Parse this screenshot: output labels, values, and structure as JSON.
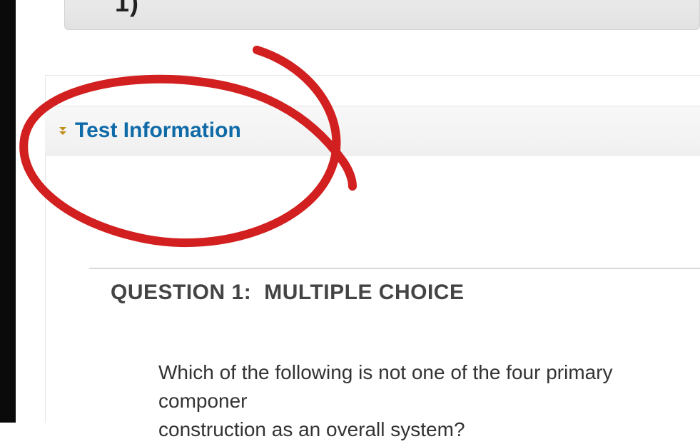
{
  "top_bar": {
    "partial_label": "1)"
  },
  "test_info": {
    "heading": "Test Information"
  },
  "question": {
    "number_label": "QUESTION 1:",
    "type_label": "MULTIPLE CHOICE",
    "prompt": "Which of the following is not one of the four primary componer\nconstruction as an overall system?"
  }
}
